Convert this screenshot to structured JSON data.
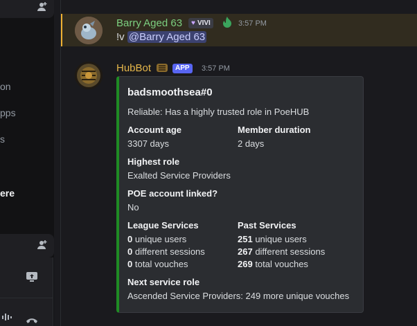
{
  "sidebar": {
    "fragments": [
      "on",
      "pps",
      "s",
      "ere"
    ]
  },
  "messages": [
    {
      "username": "Barry Aged 63",
      "tag": "VIVI",
      "time": "3:57 PM",
      "command": "!v",
      "mention": "@Barry Aged 63"
    },
    {
      "username": "HubBot",
      "badge": "APP",
      "time": "3:57 PM"
    }
  ],
  "embed": {
    "title": "badsmoothsea#0",
    "description": "Reliable: Has a highly trusted role in PoeHUB",
    "account_age_label": "Account age",
    "account_age_value": "3307 days",
    "member_duration_label": "Member duration",
    "member_duration_value": "2 days",
    "highest_role_label": "Highest role",
    "highest_role_value": "Exalted Service Providers",
    "poe_linked_label": "POE account linked?",
    "poe_linked_value": "No",
    "league_label": "League Services",
    "league": {
      "unique_users_num": "0",
      "unique_users_text": " unique users",
      "sessions_num": "0",
      "sessions_text": " different sessions",
      "vouches_num": "0",
      "vouches_text": " total vouches"
    },
    "past_label": "Past Services",
    "past": {
      "unique_users_num": "251",
      "unique_users_text": " unique users",
      "sessions_num": "267",
      "sessions_text": " different sessions",
      "vouches_num": "269",
      "vouches_text": " total vouches"
    },
    "next_role_label": "Next service role",
    "next_role_value": "Ascended Service Providers: 249 more unique vouches"
  },
  "colors": {
    "embed_accent": "#1f8b24",
    "mention_bar": "#f0b132",
    "barry_name": "#7ccf80",
    "hubbot_name": "#e5b64a",
    "app_badge": "#5865f2"
  }
}
